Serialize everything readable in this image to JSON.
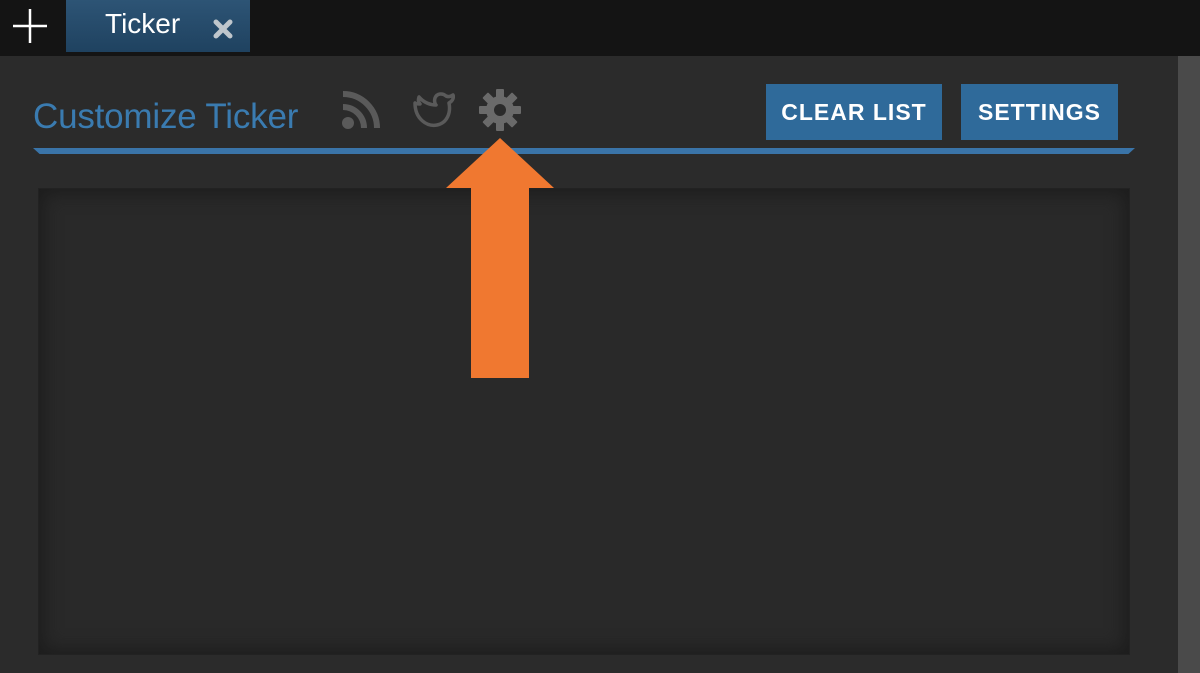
{
  "tabs": {
    "add_icon": "plus-icon",
    "active_tab_label": "Ticker",
    "close_icon": "close-x-icon"
  },
  "panel": {
    "title": "Customize Ticker",
    "icons": [
      "rss-icon",
      "twitter-bird-icon",
      "gear-icon"
    ],
    "clear_list_label": "CLEAR LIST",
    "settings_label": "SETTINGS"
  },
  "annotation": {
    "arrow_color": "#f07830",
    "arrow_points_to": "gear-icon"
  },
  "colors": {
    "accent": "#3a7bb0",
    "button_bg": "#2f6a9a",
    "panel_bg": "#2b2b2b",
    "topbar_bg": "#141414"
  }
}
